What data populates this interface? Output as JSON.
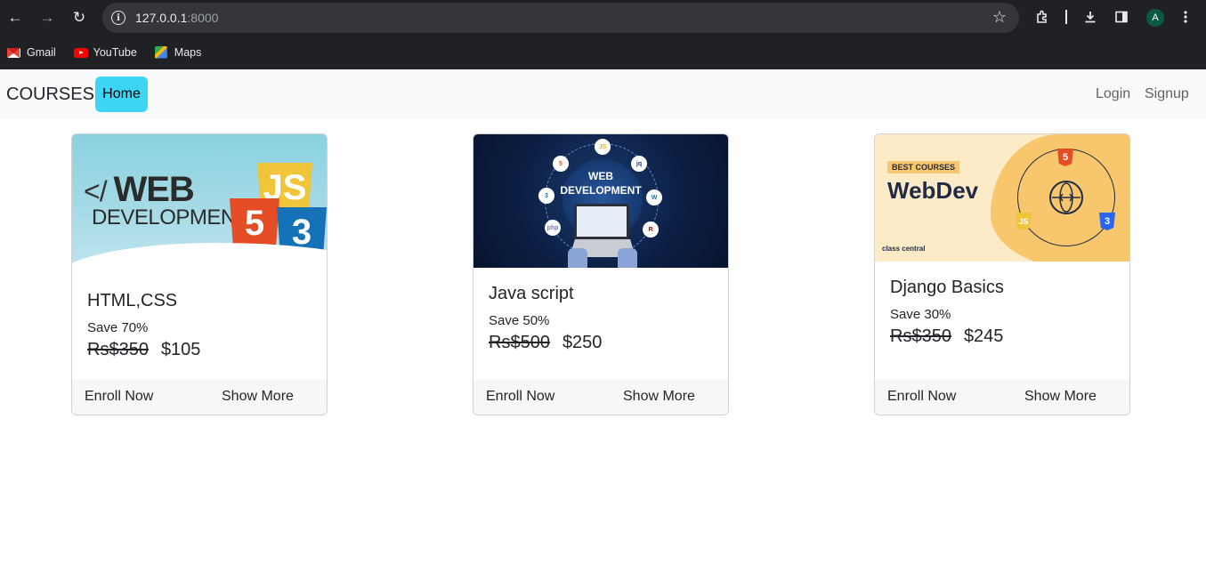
{
  "browser": {
    "url_host": "127.0.0.1",
    "url_port": ":8000",
    "bookmarks": [
      {
        "label": "Gmail",
        "icon": "gmail-icon"
      },
      {
        "label": "YouTube",
        "icon": "youtube-icon"
      },
      {
        "label": "Maps",
        "icon": "maps-icon"
      }
    ],
    "profile_initial": "A"
  },
  "navbar": {
    "brand": "COURSES",
    "home": "Home",
    "login": "Login",
    "signup": "Signup"
  },
  "colors": {
    "home_button": "#3dd5f3",
    "navbar_bg": "#f8f9fa",
    "chrome_bg": "#202124"
  },
  "courses": [
    {
      "title": "HTML,CSS",
      "save": "Save 70%",
      "old_price": "Rs$350",
      "new_price": "$105",
      "enroll": "Enroll Now",
      "more": "Show More",
      "image": {
        "line1": "WEB",
        "line2": "DEVELOPMENT",
        "badge1": "JS",
        "badge2": "5",
        "badge3": "3"
      }
    },
    {
      "title": "Java script",
      "save": "Save 50%",
      "old_price": "Rs$500",
      "new_price": "$250",
      "enroll": "Enroll Now",
      "more": "Show More",
      "image": {
        "line1": "WEB",
        "line2": "DEVELOPMENT"
      }
    },
    {
      "title": "Django Basics",
      "save": "Save 30%",
      "old_price": "Rs$350",
      "new_price": "$245",
      "enroll": "Enroll Now",
      "more": "Show More",
      "image": {
        "tag": "BEST COURSES",
        "heading": "WebDev",
        "brand": "class central",
        "badge1": "5",
        "badge2": "JS",
        "badge3": "3"
      }
    }
  ]
}
